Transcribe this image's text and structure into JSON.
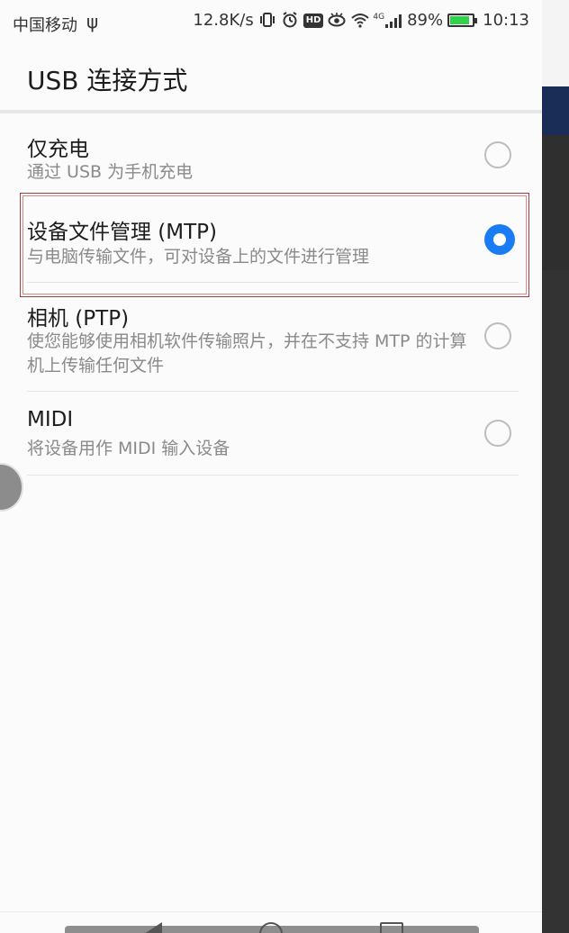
{
  "status_bar": {
    "carrier": "中国移动",
    "usb_icon": "usb-icon",
    "net_speed": "12.8K/s",
    "icons": [
      "vibrate-icon",
      "alarm-icon",
      "hd-icon",
      "eye-icon",
      "wifi-icon",
      "signal-icon"
    ],
    "hd_text": "HD",
    "network_type": "4G",
    "battery_percent": "89%",
    "battery_level": 0.89,
    "battery_color": "#2fd24a",
    "time": "10:13"
  },
  "page": {
    "title": "USB 连接方式"
  },
  "options": [
    {
      "label": "仅充电",
      "description": "通过 USB 为手机充电",
      "selected": false
    },
    {
      "label": "设备文件管理 (MTP)",
      "description": "与电脑传输文件，可对设备上的文件进行管理",
      "selected": true
    },
    {
      "label": "相机 (PTP)",
      "description": "使您能够使用相机软件传输照片，并在不支持 MTP 的计算机上传输任何文件",
      "selected": false
    },
    {
      "label": "MIDI",
      "description": "将设备用作 MIDI 输入设备",
      "selected": false
    }
  ],
  "colors": {
    "accent": "#1a7cf3",
    "highlight_border": "#b33a3a"
  },
  "nav": {
    "icons": [
      "back-icon",
      "home-icon",
      "recent-apps-icon"
    ]
  }
}
